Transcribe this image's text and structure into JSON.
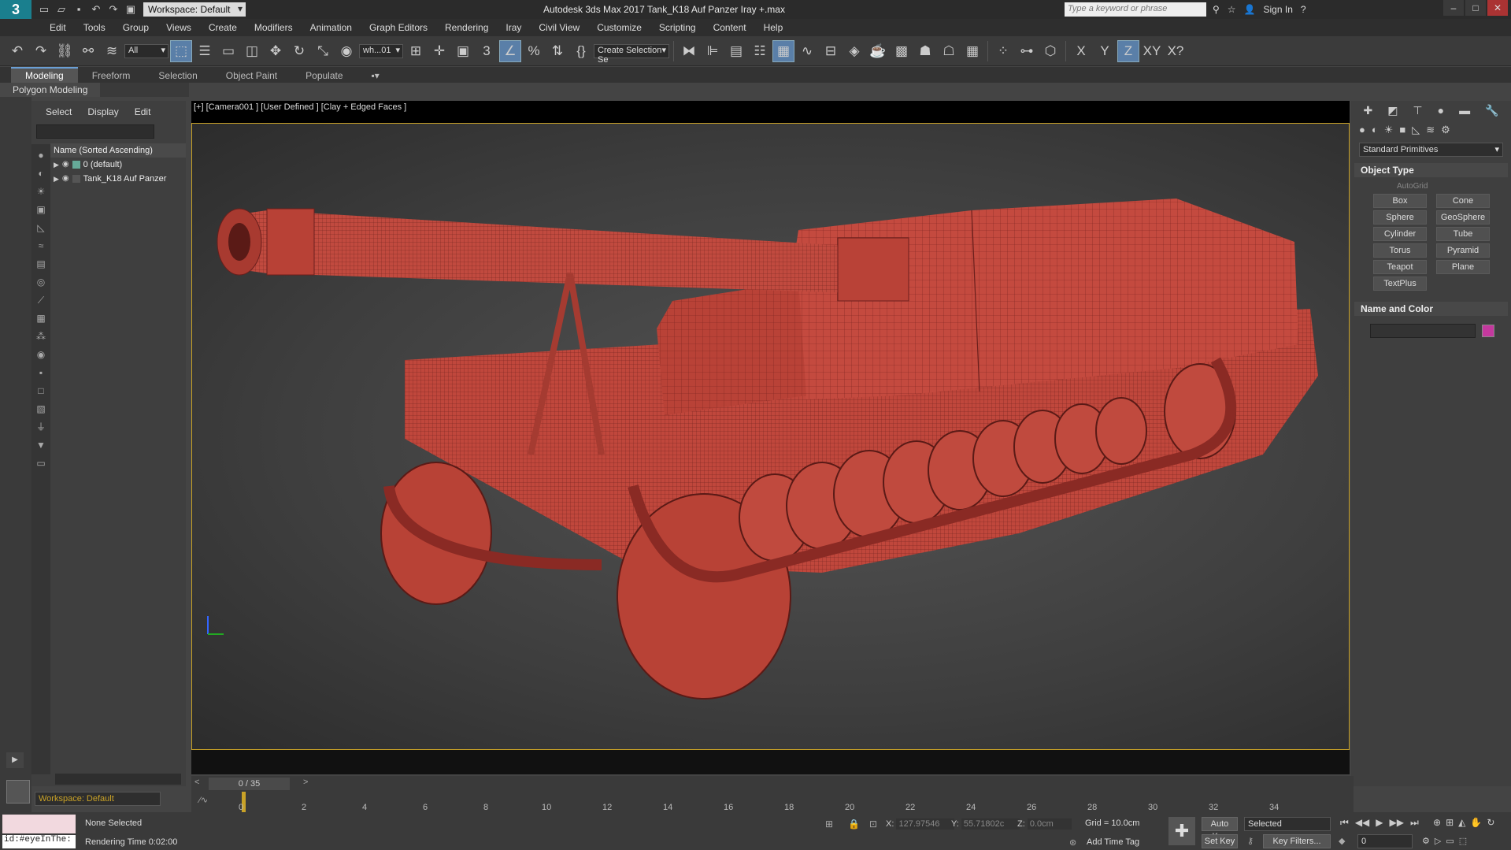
{
  "titlebar": {
    "logo": "3",
    "workspace": "Workspace: Default",
    "title": "Autodesk 3ds Max 2017    Tank_K18 Auf Panzer Iray +.max",
    "search_placeholder": "Type a keyword or phrase",
    "signin": "Sign In"
  },
  "menu": [
    "Edit",
    "Tools",
    "Group",
    "Views",
    "Create",
    "Modifiers",
    "Animation",
    "Graph Editors",
    "Rendering",
    "Iray",
    "Civil View",
    "Customize",
    "Scripting",
    "Content",
    "Help"
  ],
  "toolbar": {
    "filter": "All",
    "refcoord": "wh...01",
    "selset": "Create Selection Se",
    "axes": [
      "X",
      "Y",
      "Z",
      "XY",
      "X?"
    ]
  },
  "ribbon": {
    "tabs": [
      "Modeling",
      "Freeform",
      "Selection",
      "Object Paint",
      "Populate"
    ],
    "subtab": "Polygon Modeling"
  },
  "scene": {
    "tabs": [
      "Select",
      "Display",
      "Edit"
    ],
    "header": "Name (Sorted Ascending)",
    "rows": [
      "0 (default)",
      "Tank_K18 Auf Panzer"
    ],
    "workspace": "Workspace: Default"
  },
  "viewport": {
    "label": "[+] [Camera001 ] [User Defined ] [Clay + Edged Faces ]",
    "model_color": "#c0473c"
  },
  "cmdpanel": {
    "dropdown": "Standard Primitives",
    "object_type": "Object Type",
    "autogrid": "AutoGrid",
    "buttons": [
      "Box",
      "Cone",
      "Sphere",
      "GeoSphere",
      "Cylinder",
      "Tube",
      "Torus",
      "Pyramid",
      "Teapot",
      "Plane",
      "TextPlus"
    ],
    "name_color": "Name and Color",
    "swatch": "#c4389e"
  },
  "timeslider": {
    "frame": "0 / 35"
  },
  "timeline": {
    "ticks": [
      "0",
      "2",
      "4",
      "6",
      "8",
      "10",
      "12",
      "14",
      "16",
      "18",
      "20",
      "22",
      "24",
      "26",
      "28",
      "30",
      "32",
      "34"
    ]
  },
  "status": {
    "maxscript": "id:#eyeInThe:",
    "selection": "None Selected",
    "rendertime": "Rendering Time  0:02:00",
    "x_label": "X:",
    "x": "127.97546",
    "y_label": "Y:",
    "y": "55.71802c",
    "z_label": "Z:",
    "z": "0.0cm",
    "grid": "Grid = 10.0cm",
    "addtimetag": "Add Time Tag",
    "autokey": "Auto Key",
    "selected": "Selected",
    "setkey": "Set Key",
    "keyfilters": "Key Filters...",
    "frame": "0"
  }
}
